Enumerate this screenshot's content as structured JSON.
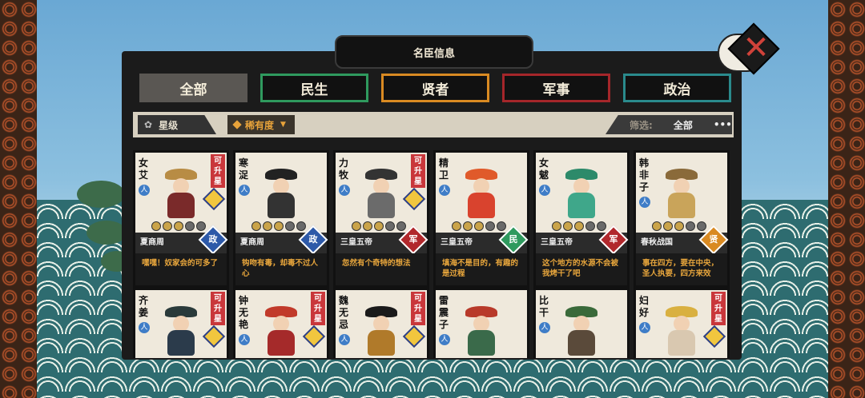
{
  "window": {
    "title": "名臣信息"
  },
  "tabs": [
    {
      "label": "全部",
      "color": "#5a5753"
    },
    {
      "label": "民生",
      "color": "#2f9a5e"
    },
    {
      "label": "贤者",
      "color": "#d98a22"
    },
    {
      "label": "军事",
      "color": "#a5262a"
    },
    {
      "label": "政治",
      "color": "#2a8a8c"
    }
  ],
  "filters": {
    "star_label": "星级",
    "rarity_label": "稀有度",
    "filter_prefix": "筛选:",
    "filter_value": "全部",
    "more": "•••"
  },
  "cards": [
    {
      "name": "女艾",
      "upgrade": "可升星",
      "era": "夏商周",
      "category": "政",
      "cat_color": "#2d59a8",
      "quote": "嘿嘿！奴家会的可多了",
      "stars": 3,
      "hat": "#b88c44",
      "robe": "#7a2a2a"
    },
    {
      "name": "寒浞",
      "upgrade": "",
      "era": "夏商周",
      "category": "政",
      "cat_color": "#2d59a8",
      "quote": "钩吻有毒，却毒不过人心",
      "stars": 3,
      "hat": "#222",
      "robe": "#333"
    },
    {
      "name": "力牧",
      "upgrade": "可升星",
      "era": "三皇五帝",
      "category": "军",
      "cat_color": "#b1282c",
      "quote": "忽然有个奇特的想法",
      "stars": 3,
      "hat": "#333",
      "robe": "#6b6b6b"
    },
    {
      "name": "精卫",
      "upgrade": "",
      "era": "三皇五帝",
      "category": "民",
      "cat_color": "#2f9a5e",
      "quote": "填海不是目的，有趣的是过程",
      "stars": 3,
      "hat": "#e05a2a",
      "robe": "#d9432e"
    },
    {
      "name": "女魃",
      "upgrade": "",
      "era": "三皇五帝",
      "category": "军",
      "cat_color": "#b1282c",
      "quote": "这个地方的水源不会被我烤干了吧",
      "stars": 3,
      "hat": "#2d8a6a",
      "robe": "#3fa78a"
    },
    {
      "name": "韩非子",
      "upgrade": "",
      "era": "春秋战国",
      "category": "贤",
      "cat_color": "#d98a22",
      "quote": "事在四方，要在中央，圣人执要，四方来效",
      "stars": 3,
      "hat": "#8a6a3a",
      "robe": "#c9a45a"
    },
    {
      "name": "齐姜",
      "upgrade": "可升星",
      "era": "",
      "category": "",
      "cat_color": "#2d59a8",
      "quote": "",
      "stars": 0,
      "hat": "#2a3a3a",
      "robe": "#2b3b4b"
    },
    {
      "name": "钟无艳",
      "upgrade": "可升星",
      "era": "",
      "category": "",
      "cat_color": "#2d59a8",
      "quote": "",
      "stars": 0,
      "hat": "#c13a2a",
      "robe": "#a52a2a"
    },
    {
      "name": "魏无忌",
      "upgrade": "可升星",
      "era": "",
      "category": "",
      "cat_color": "#2d59a8",
      "quote": "",
      "stars": 0,
      "hat": "#1a1a1a",
      "robe": "#b07a2a"
    },
    {
      "name": "雷震子",
      "upgrade": "",
      "era": "",
      "category": "",
      "cat_color": "#2d59a8",
      "quote": "",
      "stars": 0,
      "hat": "#b83a2a",
      "robe": "#3a6a4a"
    },
    {
      "name": "比干",
      "upgrade": "",
      "era": "",
      "category": "",
      "cat_color": "#2d59a8",
      "quote": "",
      "stars": 0,
      "hat": "#3a6a3a",
      "robe": "#5a4a3a"
    },
    {
      "name": "妇好",
      "upgrade": "可升星",
      "era": "",
      "category": "",
      "cat_color": "#2d59a8",
      "quote": "",
      "stars": 0,
      "hat": "#d9b040",
      "robe": "#d9c8b0"
    }
  ]
}
